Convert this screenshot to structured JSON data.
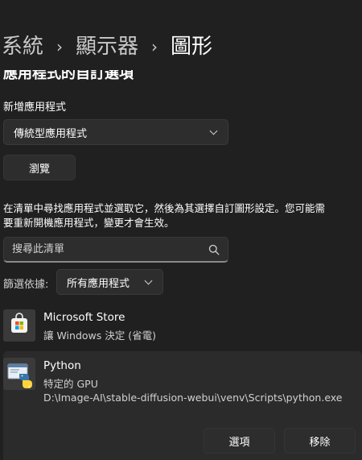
{
  "breadcrumb": {
    "parent1": "系統",
    "parent2": "顯示器",
    "current": "圖形"
  },
  "section": {
    "heading": "應用程式的自訂選項"
  },
  "add_app": {
    "label": "新增應用程式",
    "type_value": "傳統型應用程式",
    "browse_label": "瀏覽"
  },
  "description": {
    "line1": "在清單中尋找應用程式並選取它，然後為其選擇自訂圖形設定。您可能需",
    "line2": "要重新開機應用程式，變更才會生效。"
  },
  "search": {
    "placeholder": "搜尋此清單"
  },
  "filter": {
    "label": "篩選依據:",
    "value": "所有應用程式"
  },
  "apps": [
    {
      "name": "Microsoft Store",
      "subtitle": "讓 Windows 決定 (省電)"
    },
    {
      "name": "Python",
      "subtitle": "特定的 GPU",
      "path": "D:\\Image-AI\\stable-diffusion-webui\\venv\\Scripts\\python.exe",
      "options_label": "選項",
      "remove_label": "移除"
    }
  ],
  "colors": {
    "background": "#202020",
    "card": "#2b2b2b",
    "control": "#2d2d2d",
    "accent": "#4cc2ff"
  }
}
